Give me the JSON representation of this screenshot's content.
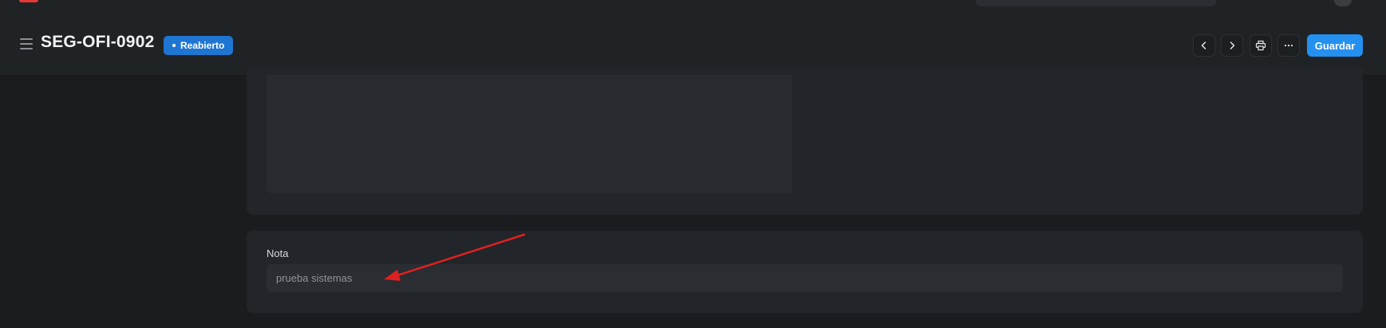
{
  "header": {
    "document_id": "SEG-OFI-0902",
    "status": "Reabierto",
    "save_label": "Guardar"
  },
  "icons": {
    "menu": "hamburger-icon",
    "prev": "chevron-left-icon",
    "next": "chevron-right-icon",
    "print": "printer-icon",
    "more": "ellipsis-icon"
  },
  "note": {
    "label": "Nota",
    "value": "prueba sistemas"
  },
  "colors": {
    "accent": "#2490ef",
    "badge": "#1f76d2",
    "annotation_arrow": "#e02020"
  }
}
